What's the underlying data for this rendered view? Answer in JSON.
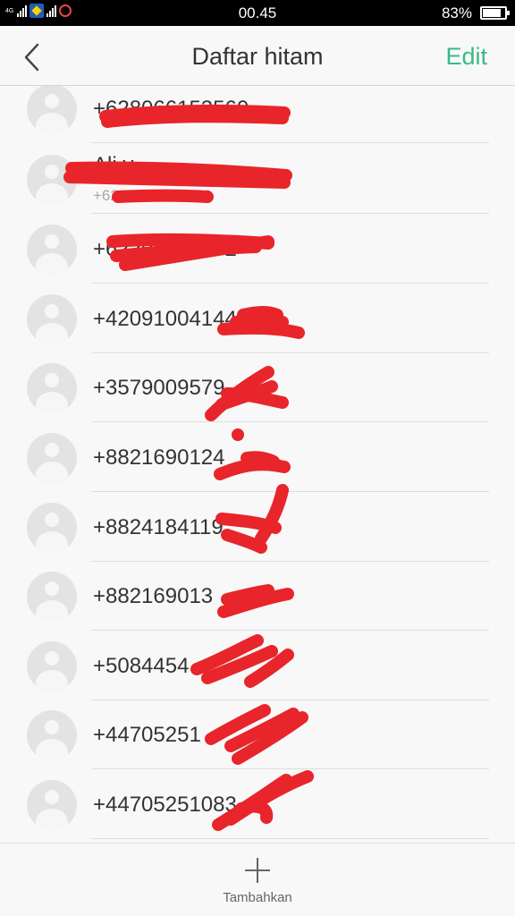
{
  "status_bar": {
    "time": "00.45",
    "battery_text": "83%",
    "battery_level": 0.83,
    "network_label": "4G"
  },
  "header": {
    "title": "Daftar hitam",
    "edit_label": "Edit",
    "back_icon": "chevron-left-icon"
  },
  "contacts": [
    {
      "number": "+628066153560"
    },
    {
      "name": "Ali y",
      "number": "+6282120588730"
    },
    {
      "number": "+62298777772"
    },
    {
      "number": "+42091004144"
    },
    {
      "number": "+3579009579"
    },
    {
      "number": "+8821690124"
    },
    {
      "number": "+8824184119"
    },
    {
      "number": "+882169013"
    },
    {
      "number": "+5084454"
    },
    {
      "number": "+44705251"
    },
    {
      "number": "+44705251083"
    }
  ],
  "footer": {
    "add_label": "Tambahkan",
    "add_icon": "plus-icon"
  },
  "colors": {
    "accent": "#3bb98a",
    "redaction": "#e8252a"
  }
}
